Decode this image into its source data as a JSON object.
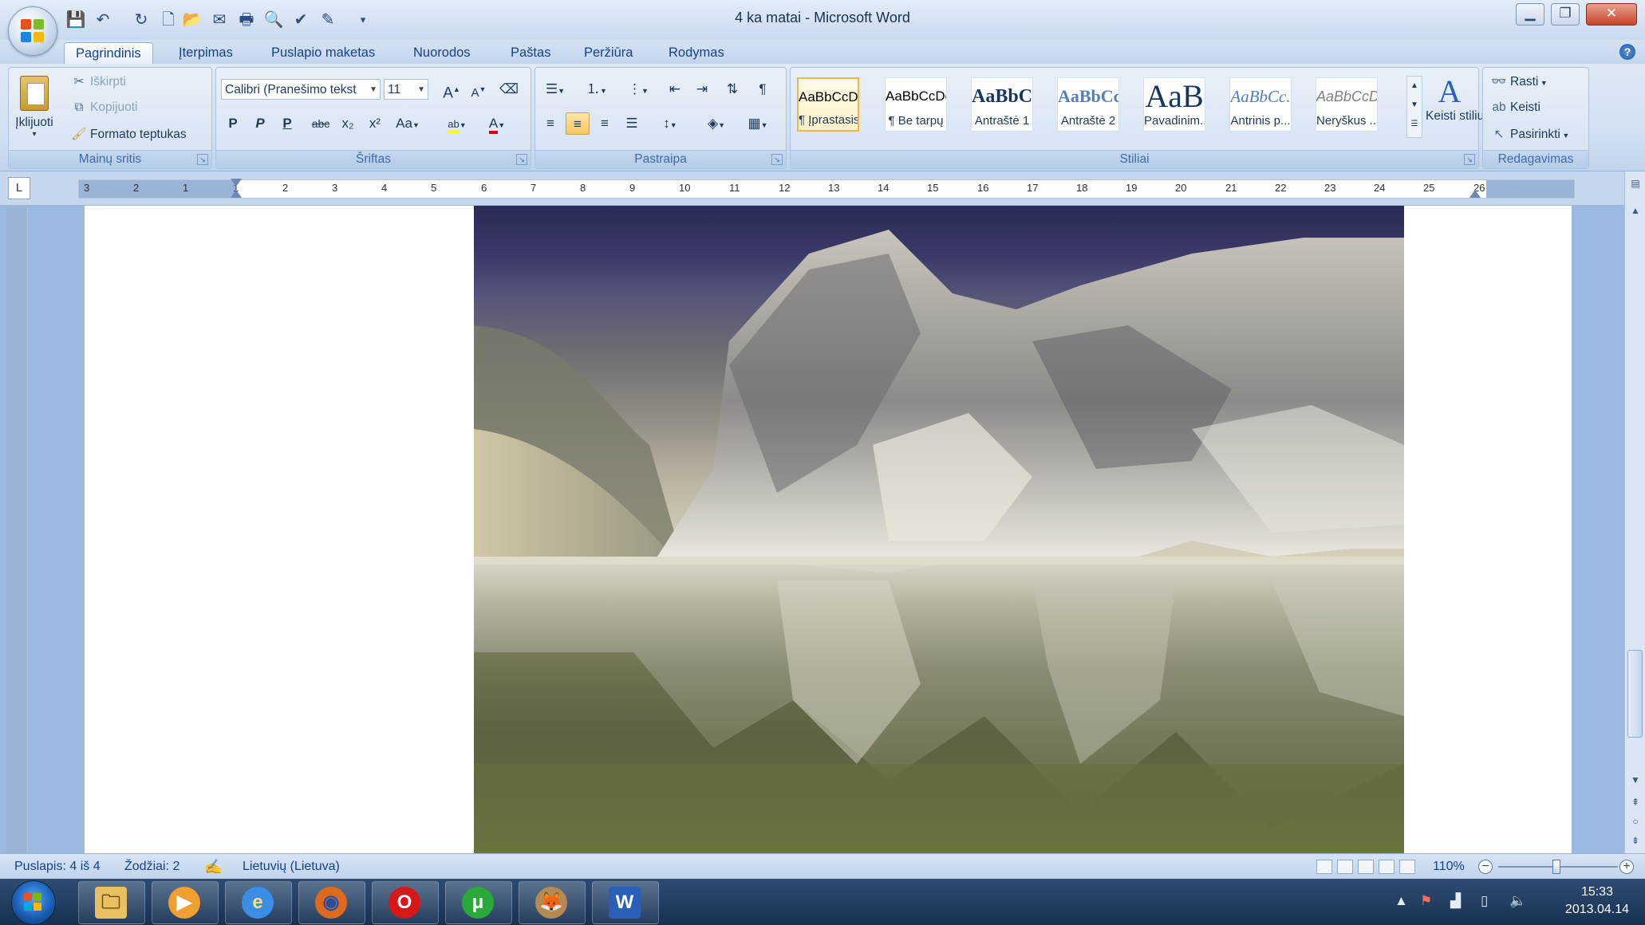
{
  "window": {
    "title": "4 ka matai - Microsoft Word",
    "controls": {
      "minimize": "▁",
      "restore": "❐",
      "close": "✕"
    }
  },
  "quick_access": [
    {
      "name": "save-icon",
      "glyph": "💾"
    },
    {
      "name": "undo-icon",
      "glyph": "↶"
    },
    {
      "name": "redo-icon",
      "glyph": "↻"
    },
    {
      "name": "new-document-icon",
      "glyph": "🗋"
    },
    {
      "name": "open-icon",
      "glyph": "📂"
    },
    {
      "name": "email-icon",
      "glyph": "✉"
    },
    {
      "name": "print-icon",
      "glyph": "🖶"
    },
    {
      "name": "print-preview-icon",
      "glyph": "🔍"
    },
    {
      "name": "spelling-icon",
      "glyph": "✔"
    },
    {
      "name": "draw-table-icon",
      "glyph": "✎"
    },
    {
      "name": "customize-qat-icon",
      "glyph": "▾"
    }
  ],
  "tabs": [
    "Pagrindinis",
    "Įterpimas",
    "Puslapio maketas",
    "Nuorodos",
    "Paštas",
    "Peržiūra",
    "Rodymas"
  ],
  "active_tab": "Pagrindinis",
  "clipboard": {
    "label": "Mainų sritis",
    "paste": "Įklijuoti",
    "cut": "Iškirpti",
    "copy": "Kopijuoti",
    "format_painter": "Formato teptukas"
  },
  "font": {
    "label": "Šriftas",
    "family": "Calibri (Pranešimo tekst",
    "size": "11",
    "grow": "A",
    "shrink": "A",
    "bold": "P",
    "italic": "P",
    "underline": "P",
    "strike": "abc",
    "subscript": "x₂",
    "superscript": "x²",
    "change_case": "Aa",
    "highlight": "ab",
    "font_color": "A",
    "highlight_color": "#ffff00",
    "font_color_value": "#e00000"
  },
  "paragraph": {
    "label": "Pastraipa"
  },
  "styles": {
    "label": "Stiliai",
    "items": [
      {
        "preview": "AaBbCcDc",
        "name": "¶ Įprastasis",
        "selected": true
      },
      {
        "preview": "AaBbCcDc",
        "name": "¶ Be tarpų",
        "selected": false
      },
      {
        "preview": "AaBbC(",
        "name": "Antraštė 1",
        "selected": false
      },
      {
        "preview": "AaBbCc",
        "name": "Antraštė 2",
        "selected": false
      },
      {
        "preview": "AaB",
        "name": "Pavadinim...",
        "selected": false
      },
      {
        "preview": "AaBbCc.",
        "name": "Antrinis p...",
        "selected": false
      },
      {
        "preview": "AaBbCcDc",
        "name": "Neryškus ...",
        "selected": false
      }
    ],
    "change_styles": "Keisti stilius"
  },
  "editing": {
    "label": "Redagavimas",
    "find": "Rasti",
    "replace": "Keisti",
    "select": "Pasirinkti"
  },
  "ruler": {
    "numbers": [
      "3",
      "2",
      "1",
      "1",
      "2",
      "3",
      "4",
      "5",
      "6",
      "7",
      "8",
      "9",
      "10",
      "11",
      "12",
      "13",
      "14",
      "15",
      "16",
      "17",
      "18",
      "19",
      "20",
      "21",
      "22",
      "23",
      "24",
      "25",
      "26"
    ]
  },
  "statusbar": {
    "page": "Puslapis: 4 iš 4",
    "words": "Žodžiai: 2",
    "language": "Lietuvių (Lietuva)",
    "zoom": "110%"
  },
  "taskbar": {
    "apps": [
      {
        "name": "explorer-icon",
        "glyph": "🗀",
        "bg": "#e8c060",
        "fg": "#6a4a10"
      },
      {
        "name": "media-player-icon",
        "glyph": "▶",
        "bg": "#f0a030",
        "fg": "#ffffff"
      },
      {
        "name": "internet-explorer-icon",
        "glyph": "e",
        "bg": "#3a8ee6",
        "fg": "#ffe06a"
      },
      {
        "name": "firefox-icon",
        "glyph": "◉",
        "bg": "#e06a1a",
        "fg": "#2b4fa0"
      },
      {
        "name": "opera-icon",
        "glyph": "O",
        "bg": "#d81818",
        "fg": "#ffffff"
      },
      {
        "name": "utorrent-icon",
        "glyph": "μ",
        "bg": "#2aa83a",
        "fg": "#ffffff"
      },
      {
        "name": "gimp-icon",
        "glyph": "🦊",
        "bg": "#b58a52",
        "fg": "#3a2a10"
      },
      {
        "name": "word-taskbar-icon",
        "glyph": "W",
        "bg": "#2a5fb8",
        "fg": "#ffffff"
      }
    ],
    "time": "15:33",
    "date": "2013.04.14"
  }
}
